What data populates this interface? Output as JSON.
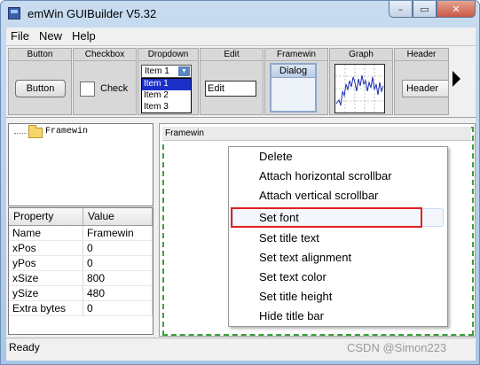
{
  "window": {
    "title": "emWin GUIBuilder V5.32",
    "min_label": "–",
    "max_label": "▭",
    "close_label": "✕"
  },
  "menu": [
    "File",
    "New",
    "Help"
  ],
  "toolbar": {
    "button": {
      "label": "Button",
      "caption": "Button"
    },
    "checkbox": {
      "label": "Checkbox",
      "caption": "Check"
    },
    "dropdown": {
      "label": "Dropdown",
      "selected": "Item 1",
      "options": [
        "Item 1",
        "Item 2",
        "Item 3"
      ]
    },
    "edit": {
      "label": "Edit",
      "value": "Edit"
    },
    "framewin": {
      "label": "Framewin",
      "caption": "Dialog"
    },
    "graph": {
      "label": "Graph"
    },
    "header": {
      "label": "Header",
      "caption": "Header"
    },
    "more_icon": "triangle-right"
  },
  "tree": {
    "root": "Framewin"
  },
  "properties": {
    "columns": [
      "Property",
      "Value"
    ],
    "rows": [
      [
        "Name",
        "Framewin"
      ],
      [
        "xPos",
        "0"
      ],
      [
        "yPos",
        "0"
      ],
      [
        "xSize",
        "800"
      ],
      [
        "ySize",
        "480"
      ],
      [
        "Extra bytes",
        "0"
      ]
    ]
  },
  "canvas": {
    "frame_title": "Framewin"
  },
  "context_menu": {
    "items": [
      "Delete",
      "Attach horizontal scrollbar",
      "Attach vertical scrollbar",
      "Set font",
      "Set title text",
      "Set text alignment",
      "Set text color",
      "Set title height",
      "Hide title bar"
    ],
    "hovered": "Set font",
    "highlight_color": "#e02020"
  },
  "status": {
    "text": "Ready"
  },
  "watermark": "CSDN @Simon223"
}
